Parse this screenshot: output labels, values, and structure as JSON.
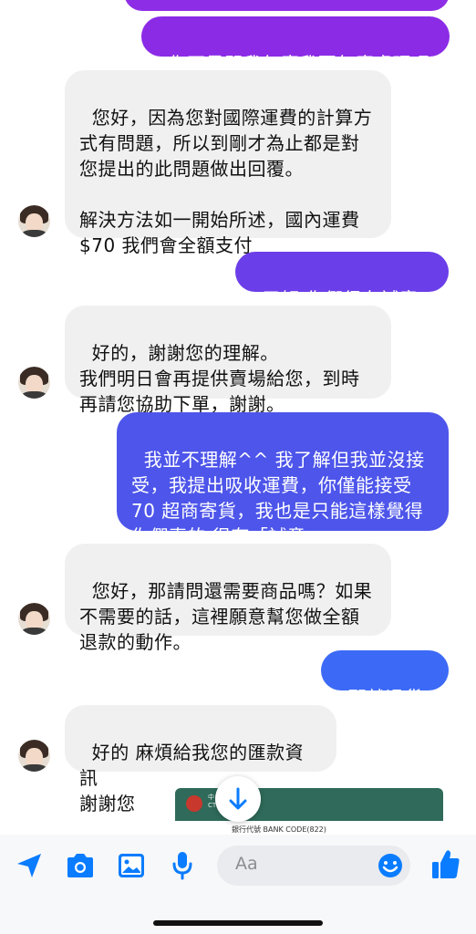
{
  "messages": [
    {
      "side": "out",
      "text": "",
      "style": "partial"
    },
    {
      "side": "out",
      "text": "你不是問我怎麼我要怎麼處理嗎"
    },
    {
      "side": "in",
      "text": "您好，因為您對國際運費的計算方\n式有問題，所以到剛才為止都是對\n您提出的此問題做出回覆。\n\n解決方法如一開始所述，國內運費\n$70 我們會全額支付"
    },
    {
      "side": "out",
      "text": "了解 你們很有誠意^^"
    },
    {
      "side": "in",
      "text": "好的，謝謝您的理解。\n我們明日會再提供賣場給您，到時\n再請您協助下單，謝謝。"
    },
    {
      "side": "out",
      "text": "我並不理解^^ 我了解但我並沒接\n受，我提出吸收運費，你僅能接受\n70 超商寄貨，我也是只能這樣覺得\n你們真的 很有「誠意」"
    },
    {
      "side": "in",
      "text": "您好，那請問還需要商品嗎？如果\n不需要的話，這裡願意幫您做全額\n退款的動作。"
    },
    {
      "side": "out",
      "text": "那就退貨吧"
    },
    {
      "side": "in",
      "text": "好的 麻煩給我您的匯款資訊\n謝謝您"
    }
  ],
  "attachment": {
    "bank_code_label": "銀行代號 BANK CODE(822)",
    "bank_short": "中\nCT"
  },
  "composer": {
    "placeholder": "Aa"
  },
  "colors": {
    "accent": "#0a7cff",
    "out_top": "#8a2be2",
    "out_mid": "#5b4fe8",
    "out_bottom": "#3b6cf5",
    "in_bg": "#f0f0f0"
  }
}
